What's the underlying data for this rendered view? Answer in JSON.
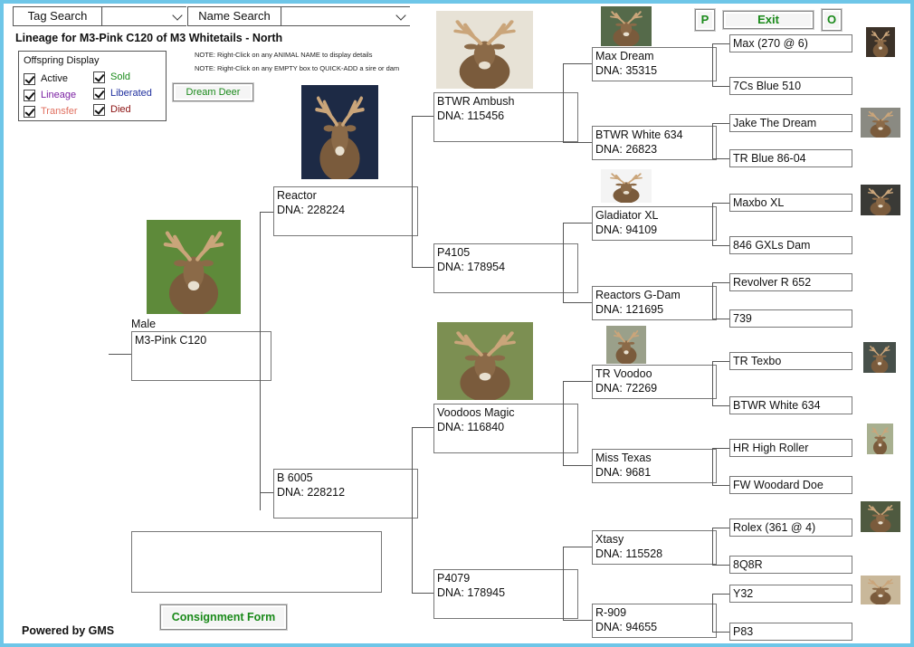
{
  "search": {
    "tag_label": "Tag Search",
    "name_label": "Name Search"
  },
  "buttons": {
    "p": "P",
    "exit": "Exit",
    "o": "O",
    "dream_deer": "Dream Deer",
    "consignment": "Consignment Form"
  },
  "title": "Lineage for M3-Pink C120 of M3 Whitetails - North",
  "notes": [
    "NOTE: Right-Click on any ANIMAL NAME to display details",
    "NOTE: Right-Click on any EMPTY box to QUICK-ADD a sire or dam"
  ],
  "offspring": {
    "title": "Offspring Display",
    "items": [
      {
        "label": "Active",
        "color": "#111111"
      },
      {
        "label": "Sold",
        "color": "#1a8a1a"
      },
      {
        "label": "Lineage",
        "color": "#7a1fa2"
      },
      {
        "label": "Liberated",
        "color": "#1f2f9e"
      },
      {
        "label": "Transfer",
        "color": "#e07060"
      },
      {
        "label": "Died",
        "color": "#8b1010"
      }
    ]
  },
  "subject": {
    "sex": "Male",
    "name": "M3-Pink C120"
  },
  "gen1": [
    {
      "name": "Reactor",
      "dna": "DNA:  228224"
    },
    {
      "name": "B 6005",
      "dna": "DNA:  228212"
    }
  ],
  "gen2": [
    {
      "name": "BTWR Ambush",
      "dna": "DNA: 115456"
    },
    {
      "name": "P4105",
      "dna": "DNA: 178954"
    },
    {
      "name": "Voodoos Magic",
      "dna": "DNA: 116840"
    },
    {
      "name": "P4079",
      "dna": "DNA: 178945"
    }
  ],
  "gen3": [
    {
      "name": "Max Dream",
      "dna": "DNA: 35315"
    },
    {
      "name": "BTWR White 634",
      "dna": "DNA: 26823"
    },
    {
      "name": "Gladiator XL",
      "dna": "DNA: 94109"
    },
    {
      "name": "Reactors G-Dam",
      "dna": "DNA: 121695"
    },
    {
      "name": "TR Voodoo",
      "dna": "DNA: 72269"
    },
    {
      "name": "Miss Texas",
      "dna": "DNA: 9681"
    },
    {
      "name": "Xtasy",
      "dna": "DNA: 115528"
    },
    {
      "name": "R-909",
      "dna": "DNA: 94655"
    }
  ],
  "gen4": [
    "Max (270 @ 6)",
    "7Cs Blue 510",
    "Jake The Dream",
    "TR Blue 86-04",
    "Maxbo XL",
    "846 GXLs Dam",
    "Revolver R 652",
    "739",
    "TR Texbo",
    "BTWR White 634",
    "HR High Roller",
    "FW Woodard Doe",
    "Rolex (361 @ 4)",
    "8Q8R",
    "Y32",
    "P83"
  ],
  "footer": "Powered by GMS"
}
